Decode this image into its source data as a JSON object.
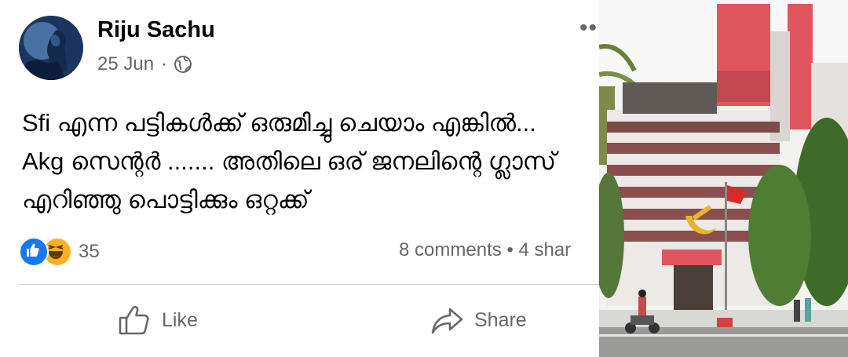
{
  "post": {
    "author": "Riju Sachu",
    "date": "25 Jun",
    "dot": "·",
    "privacy_icon": "globe-icon",
    "more_icon": "more-options-icon",
    "more_glyph": "••",
    "text_lines": [
      "Sfi എന്ന പട്ടികൾക്ക് ഒരുമിച്ചു ചെയാം എങ്കിൽ...",
      "Akg സെന്റർ ....... അതിലെ ഒര് ജനലിന്റെ ഗ്ലാസ്",
      "എറിഞ്ഞു പൊട്ടിക്കും ഒറ്റക്ക്"
    ],
    "reactions": {
      "types": [
        "like",
        "haha"
      ],
      "count": "35"
    },
    "comments_shares": "8 comments • 4 shar",
    "actions": {
      "like_label": "Like",
      "share_label": "Share"
    }
  },
  "colors": {
    "text_primary": "#050505",
    "text_secondary": "#65676b",
    "like_blue": "#1877f2",
    "haha_yellow": "#f7b125",
    "divider": "#ced0d4",
    "building_red": "#e0565e"
  }
}
